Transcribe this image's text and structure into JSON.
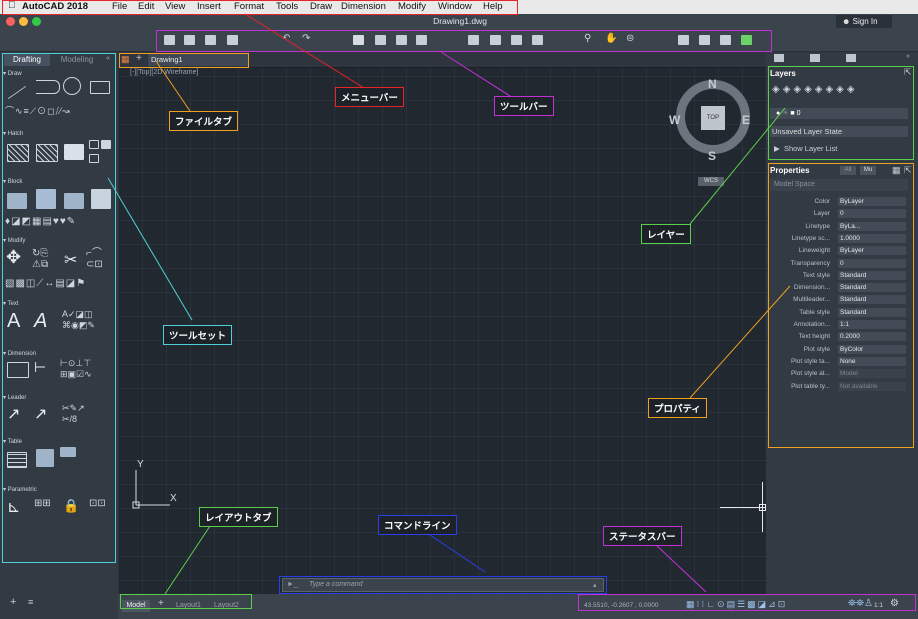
{
  "menubar": {
    "app_name": "AutoCAD 2018",
    "items": [
      "File",
      "Edit",
      "View",
      "Insert",
      "Format",
      "Tools",
      "Draw",
      "Dimension",
      "Modify",
      "Window",
      "Help"
    ]
  },
  "window": {
    "title": "Drawing1.dwg",
    "sign_in": "Sign In"
  },
  "palette": {
    "tabs": [
      "Drafting",
      "Modeling"
    ],
    "sections": [
      "Draw",
      "Hatch",
      "Block",
      "Modify",
      "Text",
      "Dimension",
      "Leader",
      "Table",
      "Parametric"
    ]
  },
  "file_tab": {
    "label": "Drawing1"
  },
  "viewport": {
    "label": "[-][Top][2D Wireframe]"
  },
  "viewcube": {
    "north": "N",
    "south": "S",
    "east": "E",
    "west": "W",
    "top": "TOP",
    "wcs": "WCS"
  },
  "ucs": {
    "x": "X",
    "y": "Y"
  },
  "layers": {
    "title": "Layers",
    "current_layer": "0",
    "layer_state": "Unsaved Layer State",
    "show_list": "Show Layer List"
  },
  "properties": {
    "title": "Properties",
    "badges": [
      "All",
      "Mu"
    ],
    "scope": "Model Space",
    "rows": [
      {
        "label": "Color",
        "value": "ByLayer"
      },
      {
        "label": "Layer",
        "value": "0"
      },
      {
        "label": "Linetype",
        "value": "ByLa..."
      },
      {
        "label": "Linetype sc...",
        "value": "1.0000"
      },
      {
        "label": "Lineweight",
        "value": "ByLayer"
      },
      {
        "label": "Transparency",
        "value": "0"
      },
      {
        "label": "Text style",
        "value": "Standard"
      },
      {
        "label": "Dimension...",
        "value": "Standard"
      },
      {
        "label": "Multileader...",
        "value": "Standard"
      },
      {
        "label": "Table style",
        "value": "Standard"
      },
      {
        "label": "Annotation...",
        "value": "1:1"
      },
      {
        "label": "Text height",
        "value": "0.2000"
      },
      {
        "label": "Plot style",
        "value": "ByColor"
      },
      {
        "label": "Plot style ta...",
        "value": "None"
      },
      {
        "label": "Plot style at...",
        "value": "Model"
      },
      {
        "label": "Plot table ty...",
        "value": "Not available"
      }
    ]
  },
  "command": {
    "placeholder": "Type a command"
  },
  "layout_tabs": [
    "Model",
    "Layout1",
    "Layout2"
  ],
  "status": {
    "coords": "43.5510, -0.2607 , 0.0000",
    "scale": "1:1"
  },
  "annotations": {
    "menubar": "メニューバー",
    "toolbar": "ツールバー",
    "filetab": "ファイルタブ",
    "toolset": "ツールセット",
    "layer": "レイヤー",
    "properties": "プロパティ",
    "layouttab": "レイアウトタブ",
    "commandline": "コマンドライン",
    "statusbar": "ステータスバー"
  },
  "colors": {
    "menubar": "#e8232a",
    "toolbar": "#c231d6",
    "filetab": "#f0a020",
    "toolset": "#4fd0d8",
    "layer": "#5ad04a",
    "properties": "#f0a020",
    "layouttab": "#5ad04a",
    "commandline": "#2b3fe6",
    "statusbar": "#c231d6"
  }
}
